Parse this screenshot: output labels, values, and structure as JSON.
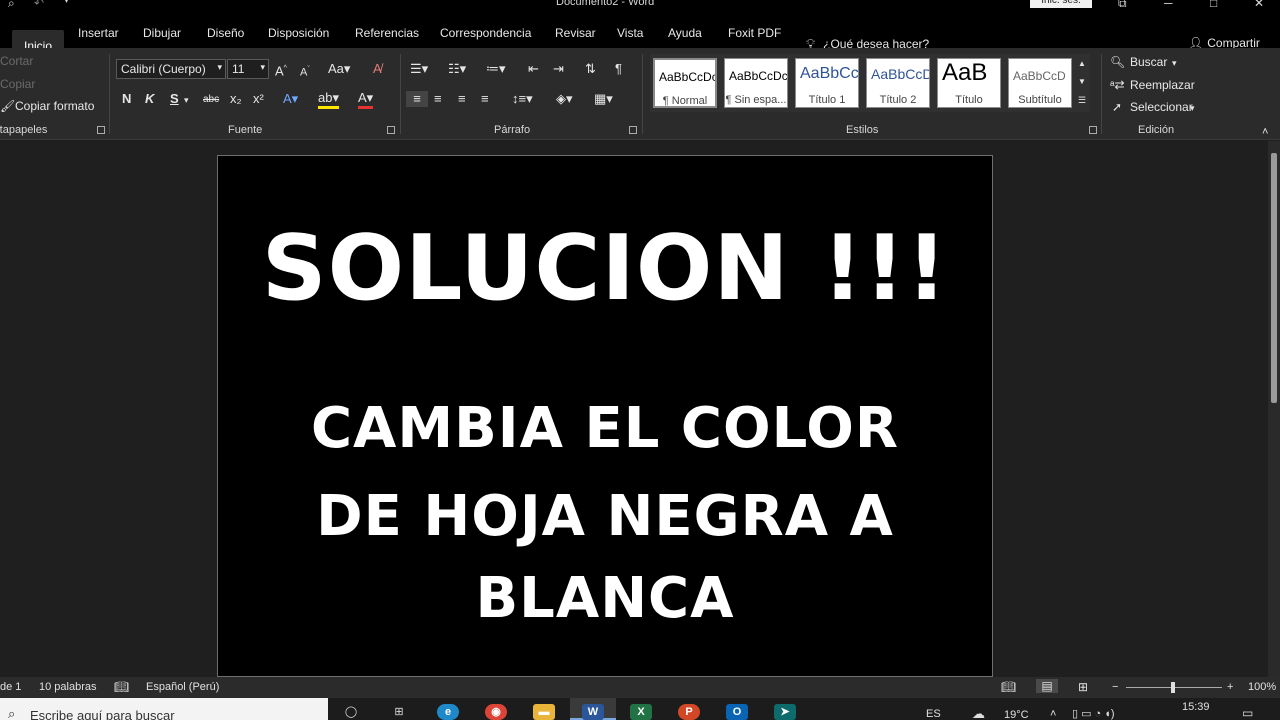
{
  "window": {
    "title": "Documento2  -  Word",
    "signin_label": "Inic. ses."
  },
  "tabs": [
    "Inicio",
    "Insertar",
    "Dibujar",
    "Diseño",
    "Disposición",
    "Referencias",
    "Correspondencia",
    "Revisar",
    "Vista",
    "Ayuda",
    "Foxit PDF"
  ],
  "tell_me": "¿Qué desea hacer?",
  "share_label": "Compartir",
  "clipboard": {
    "cut": "Cortar",
    "copy": "Copiar",
    "format_painter": "Copiar formato",
    "group_label": "rtapapeles"
  },
  "font": {
    "name": "Calibri (Cuerpo)",
    "size": "11",
    "group_label": "Fuente",
    "bold": "N",
    "italic": "K",
    "underline": "S",
    "strike": "abc",
    "subscript": "x₂",
    "superscript": "x²"
  },
  "paragraph": {
    "group_label": "Párrafo"
  },
  "styles": {
    "group_label": "Estilos",
    "items": [
      {
        "sample": "AaBbCcDc",
        "name": "¶ Normal"
      },
      {
        "sample": "AaBbCcDc",
        "name": "¶ Sin espa..."
      },
      {
        "sample": "AaBbCc",
        "name": "Título 1"
      },
      {
        "sample": "AaBbCcD",
        "name": "Título 2"
      },
      {
        "sample": "AaB",
        "name": "Título"
      },
      {
        "sample": "AaBbCcD",
        "name": "Subtítulo"
      }
    ]
  },
  "editing": {
    "find": "Buscar",
    "replace": "Reemplazar",
    "select": "Seleccionar",
    "group_label": "Edición"
  },
  "document": {
    "headline": "SOLUCION !!!",
    "line1": "CAMBIA EL COLOR",
    "line2": "DE HOJA NEGRA A",
    "line3": "BLANCA"
  },
  "status": {
    "page": "de 1",
    "words": "10 palabras",
    "language": "Español (Perú)",
    "zoom": "100%"
  },
  "taskbar": {
    "search_placeholder": "Escribe aquí para buscar",
    "lang": "ES",
    "weather": "19°C",
    "time": "15:39"
  }
}
